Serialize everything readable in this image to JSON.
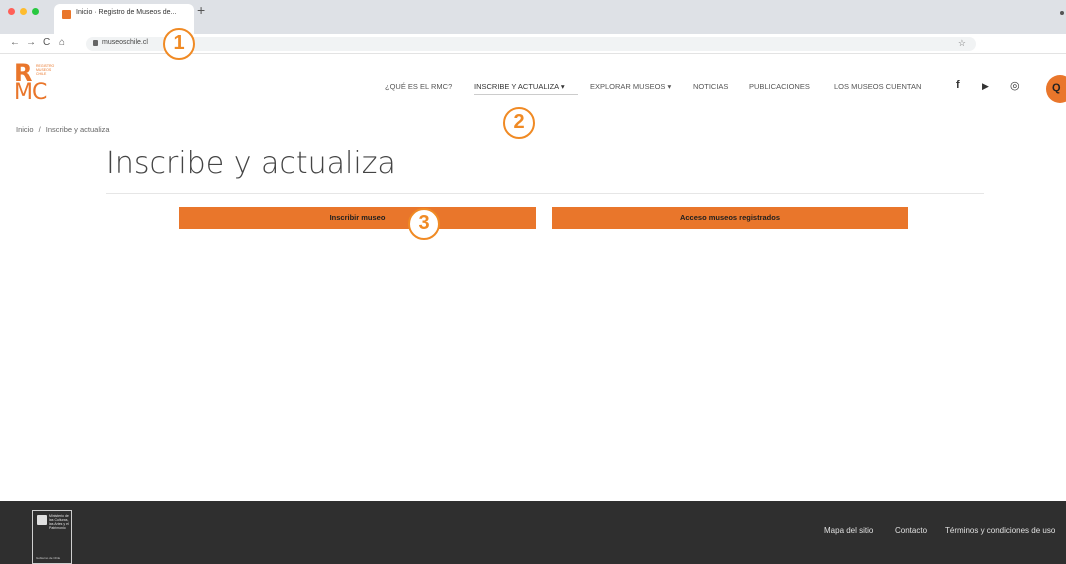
{
  "browser": {
    "tab_title": "Inicio · Registro de Museos de...",
    "new_tab": "+",
    "url": "museoschile.cl",
    "nav": {
      "back": "←",
      "forward": "→",
      "reload": "C",
      "home": "⌂"
    },
    "bookmark_icon": "star-icon"
  },
  "site": {
    "logo": {
      "letter_r": "R",
      "small_text": "REGISTRO\nMUSEOS\nCHILE",
      "letters_mc": "MC"
    },
    "menu": [
      {
        "label": "¿QUÉ ES EL RMC?"
      },
      {
        "label": "INSCRIBE Y ACTUALIZA ▾"
      },
      {
        "label": "EXPLORAR MUSEOS ▾"
      },
      {
        "label": "NOTICIAS"
      },
      {
        "label": "PUBLICACIONES"
      },
      {
        "label": "LOS MUSEOS CUENTAN"
      }
    ],
    "social": {
      "facebook": "f",
      "youtube": "▶",
      "instagram": "◎"
    },
    "search_glyph": "Q"
  },
  "breadcrumb": {
    "home": "Inicio",
    "separator": "/",
    "current": "Inscribe y actualiza"
  },
  "page": {
    "title": "Inscribe y actualiza",
    "buttons": {
      "register": "Inscribir museo",
      "access": "Acceso museos registrados"
    }
  },
  "annotations": [
    "1",
    "2",
    "3"
  ],
  "footer": {
    "ministry": "Ministerio de las Culturas, las Artes y el Patrimonio",
    "ministry_sub": "Gobierno de Chile",
    "links": [
      "Mapa del sitio",
      "Contacto",
      "Términos y condiciones de uso"
    ]
  },
  "colors": {
    "accent": "#e9762b",
    "annotation": "#f08a24",
    "footer_bg": "#2f2f2f"
  }
}
